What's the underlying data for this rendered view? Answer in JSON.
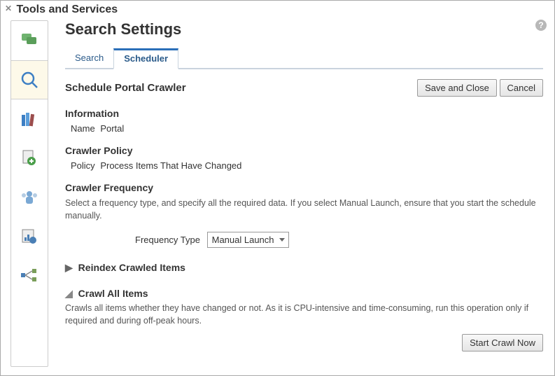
{
  "header": {
    "title": "Tools and Services"
  },
  "help_tooltip": "Help",
  "page_title": "Search Settings",
  "tabs": {
    "search": "Search",
    "scheduler": "Scheduler"
  },
  "section_title": "Schedule Portal Crawler",
  "buttons": {
    "save_close": "Save and Close",
    "cancel": "Cancel",
    "start_crawl": "Start Crawl Now"
  },
  "information": {
    "heading": "Information",
    "name_label": "Name",
    "name_value": "Portal"
  },
  "crawler_policy": {
    "heading": "Crawler Policy",
    "policy_label": "Policy",
    "policy_value": "Process Items That Have Changed"
  },
  "crawler_frequency": {
    "heading": "Crawler Frequency",
    "description": "Select a frequency type, and specify all the required data. If you select Manual Launch, ensure that you start the schedule manually.",
    "type_label": "Frequency Type",
    "type_value": "Manual Launch"
  },
  "reindex": {
    "heading": "Reindex Crawled Items"
  },
  "crawl_all": {
    "heading": "Crawl All Items",
    "description": "Crawls all items whether they have changed or not. As it is CPU-intensive and time-consuming, run this operation only if required and during off-peak hours."
  },
  "sidebar_icons": [
    "chat",
    "search",
    "library",
    "page-plus",
    "people",
    "report",
    "workflow"
  ]
}
